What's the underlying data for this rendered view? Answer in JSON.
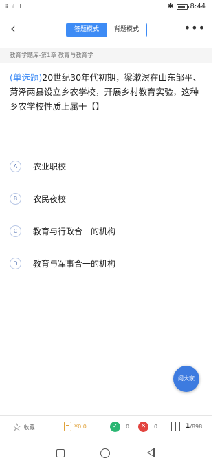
{
  "status_bar": {
    "signals": "ⅱ .ıl .ıl",
    "time": "8:44"
  },
  "header": {
    "back_icon": "chevron-left-icon",
    "tabs": [
      {
        "label": "答题模式",
        "active": true
      },
      {
        "label": "背题模式",
        "active": false
      }
    ],
    "more_icon": "more-dots-icon"
  },
  "breadcrumb": "教育学题库-第1章 教育与教育学",
  "question": {
    "type_label": "(单选题)",
    "text": "20世纪30年代初期，梁漱溟在山东邹平、菏泽两县设立乡农学校，开展乡村教育实验，这种乡农学校性质上属于【】"
  },
  "options": [
    {
      "letter": "A",
      "text": "农业职校"
    },
    {
      "letter": "B",
      "text": "农民夜校"
    },
    {
      "letter": "C",
      "text": "教育与行政合一的机构"
    },
    {
      "letter": "D",
      "text": "教育与军事合一的机构"
    }
  ],
  "fab_label": "问大家",
  "bottom_bar": {
    "favorite_label": "收藏",
    "money": "¥0.0",
    "correct_count": "0",
    "wrong_count": "0",
    "page_current": "1",
    "page_total": "/898"
  },
  "colors": {
    "accent": "#3d8bf5",
    "correct": "#2bb673",
    "wrong": "#e2443f",
    "money": "#e0a23a"
  }
}
